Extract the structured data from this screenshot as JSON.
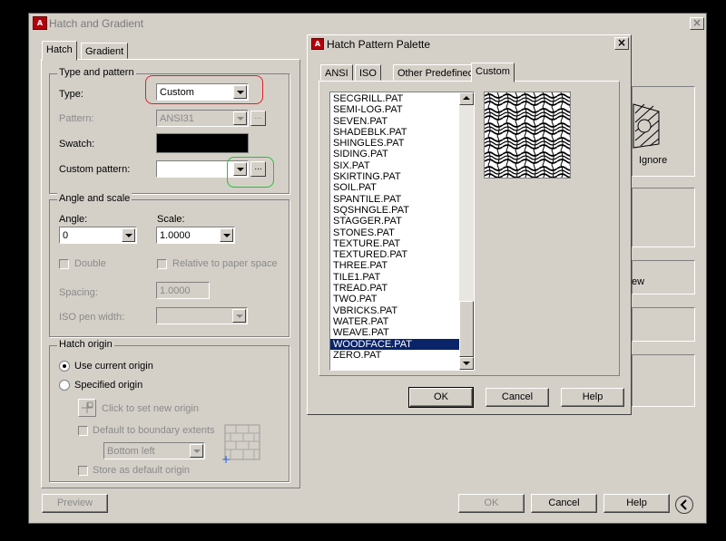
{
  "main_dialog": {
    "title": "Hatch and Gradient",
    "title_icon_text": "A",
    "close_glyph": "×",
    "tabs": [
      "Hatch",
      "Gradient"
    ],
    "type_and_pattern": {
      "legend": "Type and pattern",
      "type_label": "Type:",
      "type_value": "Custom",
      "pattern_label": "Pattern:",
      "pattern_value": "ANSI31",
      "swatch_label": "Swatch:",
      "custom_pattern_label": "Custom pattern:",
      "custom_pattern_value": "",
      "browse_label": "..."
    },
    "angle_and_scale": {
      "legend": "Angle and scale",
      "angle_label": "Angle:",
      "angle_value": "0",
      "scale_label": "Scale:",
      "scale_value": "1.0000",
      "double_label": "Double",
      "relative_label": "Relative to paper space",
      "spacing_label": "Spacing:",
      "spacing_value": "1.0000",
      "iso_pen_label": "ISO pen width:"
    },
    "hatch_origin": {
      "legend": "Hatch origin",
      "use_current": "Use current origin",
      "specified": "Specified origin",
      "click_new": "Click to set new origin",
      "default_boundary": "Default to boundary extents",
      "position_value": "Bottom left",
      "store_default": "Store as default origin"
    },
    "right_fragments": {
      "ignore": "Ignore",
      "ew": "ew"
    },
    "footer": {
      "preview": "Preview",
      "ok": "OK",
      "cancel": "Cancel",
      "help": "Help"
    }
  },
  "palette": {
    "title": "Hatch Pattern Palette",
    "close_glyph": "×",
    "tabs": [
      "ANSI",
      "ISO",
      "Other Predefined",
      "Custom"
    ],
    "active_tab": "Custom",
    "items": [
      "SECGRILL.PAT",
      "SEMI-LOG.PAT",
      "SEVEN.PAT",
      "SHADEBLK.PAT",
      "SHINGLES.PAT",
      "SIDING.PAT",
      "SIX.PAT",
      "SKIRTING.PAT",
      "SOIL.PAT",
      "SPANTILE.PAT",
      "SQSHNGLE.PAT",
      "STAGGER.PAT",
      "STONES.PAT",
      "TEXTURE.PAT",
      "TEXTURED.PAT",
      "THREE.PAT",
      "TILE1.PAT",
      "TREAD.PAT",
      "TWO.PAT",
      "VBRICKS.PAT",
      "WATER.PAT",
      "WEAVE.PAT",
      "WOODFACE.PAT",
      "ZERO.PAT"
    ],
    "selected": "WOODFACE.PAT",
    "ok": "OK",
    "cancel": "Cancel",
    "help": "Help"
  }
}
